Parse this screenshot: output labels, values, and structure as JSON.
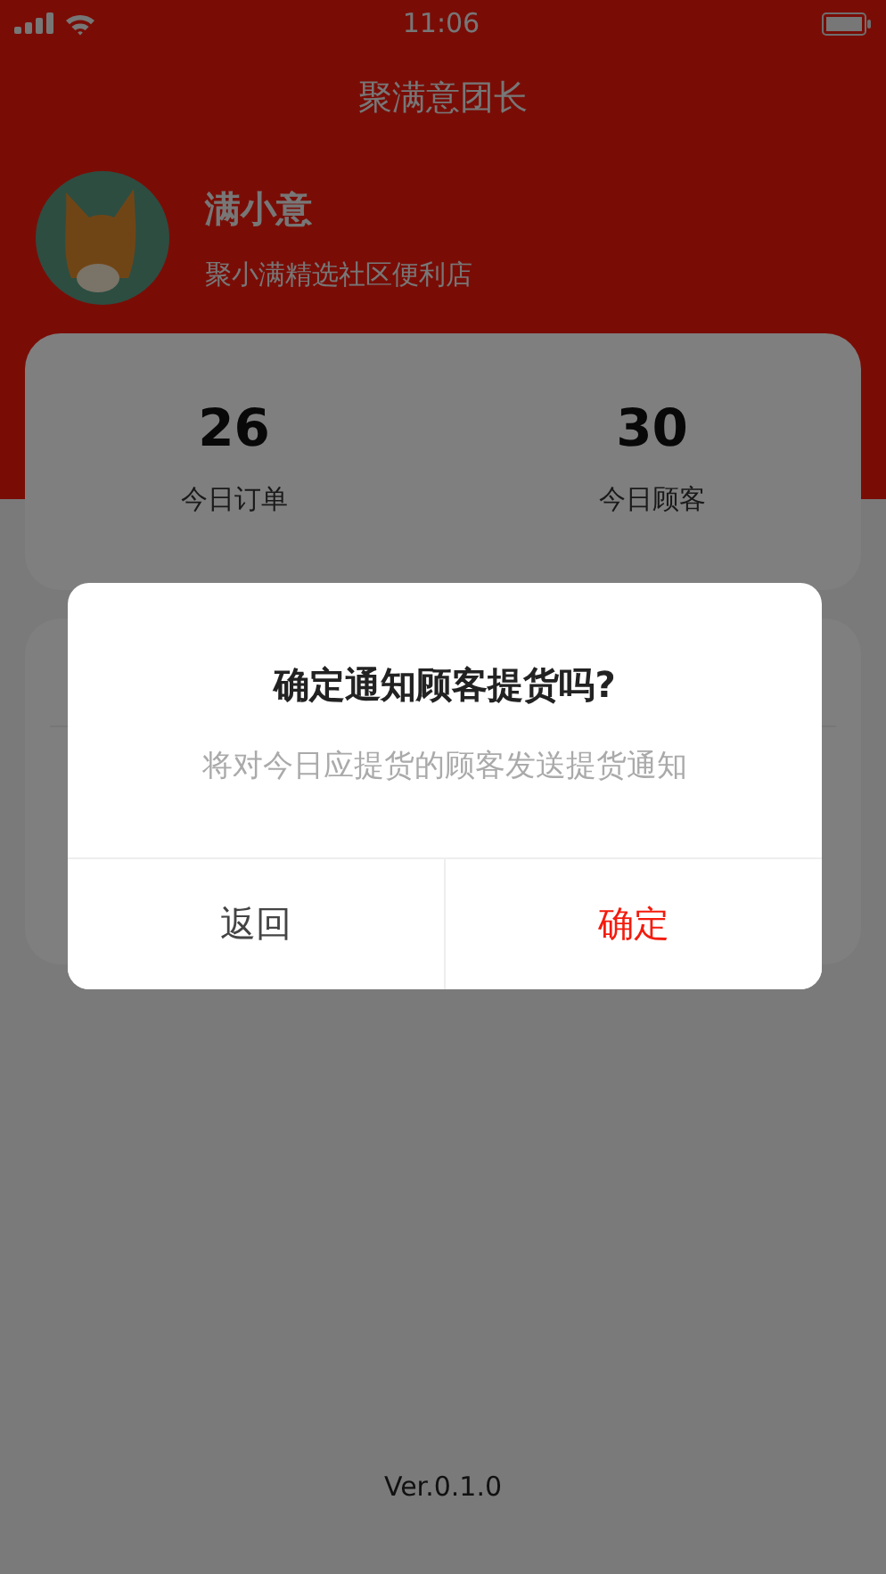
{
  "status_bar": {
    "time": "11:06"
  },
  "header": {
    "title": "聚满意团长"
  },
  "profile": {
    "name": "满小意",
    "store": "聚小满精选社区便利店"
  },
  "stats": [
    {
      "value": "26",
      "label": "今日订单"
    },
    {
      "value": "30",
      "label": "今日顾客"
    }
  ],
  "footer": {
    "version": "Ver.0.1.0"
  },
  "dialog": {
    "title": "确定通知顾客提货吗?",
    "message": "将对今日应提货的顾客发送提货通知",
    "buttons": [
      {
        "label": "返回",
        "kind": "cancel"
      },
      {
        "label": "确定",
        "kind": "confirm"
      }
    ]
  }
}
